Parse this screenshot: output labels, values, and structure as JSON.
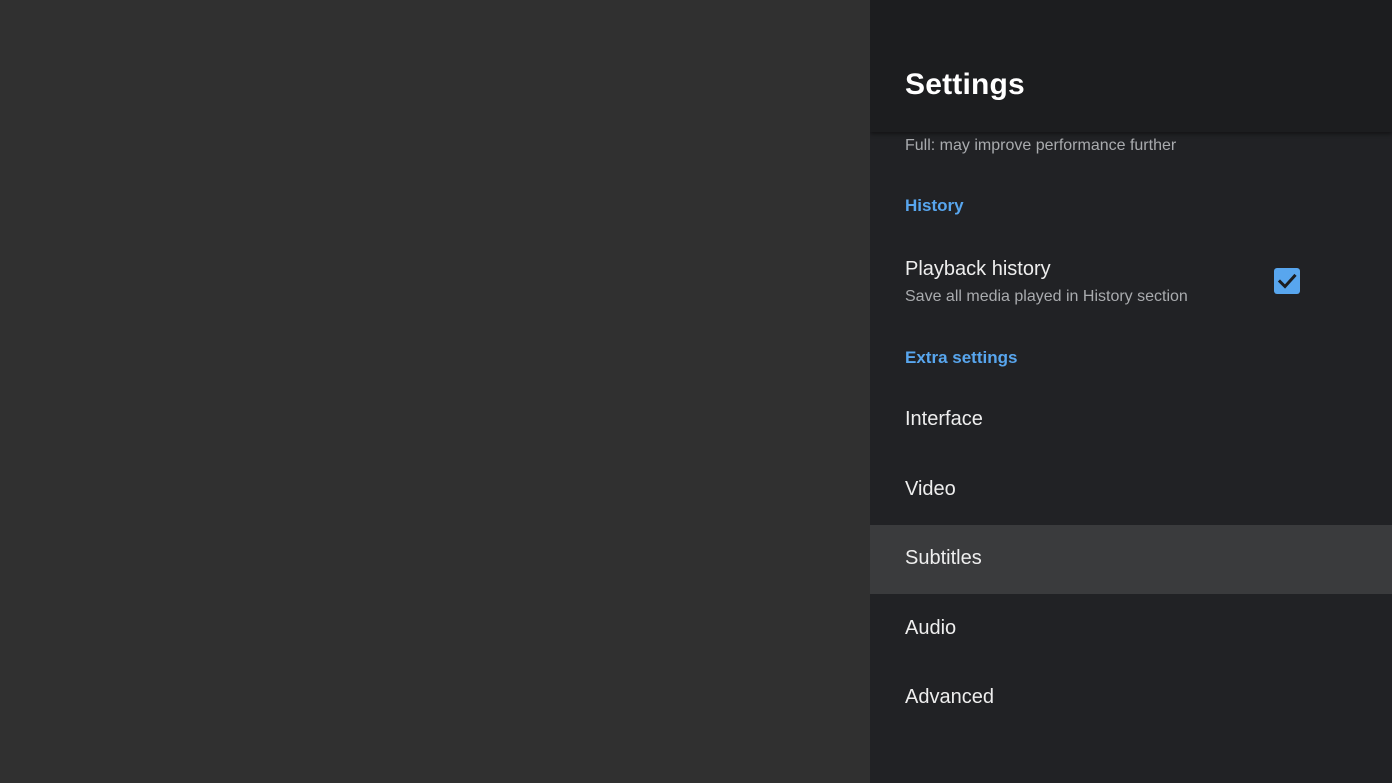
{
  "header": {
    "title": "Settings"
  },
  "clipped_summary": {
    "line_1": "Full: may improve performance further"
  },
  "sections": {
    "history": {
      "title": "History",
      "playback_history": {
        "title": "Playback history",
        "summary": "Save all media played in History section",
        "checked": true
      }
    },
    "extra": {
      "title": "Extra settings",
      "items": [
        {
          "label": "Interface"
        },
        {
          "label": "Video"
        },
        {
          "label": "Subtitles",
          "focused": true
        },
        {
          "label": "Audio"
        },
        {
          "label": "Advanced"
        }
      ]
    }
  },
  "colors": {
    "accent": "#58a6ee",
    "panel": "#212225",
    "header": "#1c1d1f",
    "backdrop": "#303030",
    "focused_row": "#3a3b3d"
  },
  "icons": {
    "checkbox": "check-icon"
  }
}
